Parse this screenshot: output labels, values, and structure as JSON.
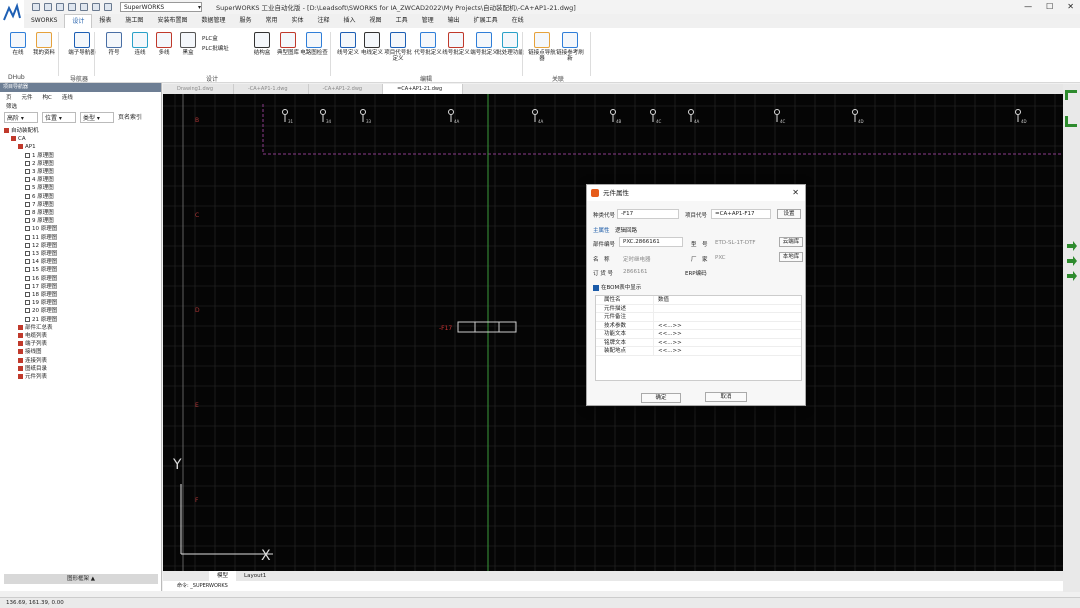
{
  "app": {
    "title": "SuperWORKS 工业自动化版 - [D:\\Leadsoft\\SWORKS for IA_ZWCAD2022\\My Projects\\自动装配机\\-CA+AP1-21.dwg]",
    "workspace": "SuperWORKS"
  },
  "ribbon_tabs": [
    "SWORKS",
    "设计",
    "报表",
    "施工图",
    "安装布置图",
    "数据管理",
    "服务",
    "常用",
    "实体",
    "注释",
    "插入",
    "视图",
    "工具",
    "管理",
    "输出",
    "扩展工具",
    "在线"
  ],
  "ribbon": {
    "buttons": [
      {
        "l": "在线"
      },
      {
        "l": "我的资料"
      },
      {
        "l": "端子导航器"
      },
      {
        "l": "符号"
      },
      {
        "l": "连线"
      },
      {
        "l": "多线"
      },
      {
        "l": "黑盒"
      },
      {
        "l": "PLC盒"
      },
      {
        "l": "PLC批编址"
      },
      {
        "l": "结构盒"
      },
      {
        "l": "典型图库"
      },
      {
        "l": "电路图检查"
      },
      {
        "l": "线号定义"
      },
      {
        "l": "电线定义"
      },
      {
        "l": "项目代号批定义"
      },
      {
        "l": "代号批定义"
      },
      {
        "l": "线号批定义"
      },
      {
        "l": "端号批定义"
      },
      {
        "l": "批处理功能"
      },
      {
        "l": "链接点导航器"
      },
      {
        "l": "链接参考刷新"
      }
    ],
    "groups": [
      "DHub",
      "导航器",
      "设计",
      "编辑",
      "关联"
    ]
  },
  "left_panel": {
    "title": "项目导航器",
    "tabs": [
      "页",
      "元件",
      "构C",
      "连线"
    ],
    "filter": "筛选",
    "selects": [
      "高阶",
      "位置",
      "类型"
    ],
    "hint": "页名索引",
    "bottom_button": "图形框架 ▲",
    "tree": [
      {
        "t": "自动装配机",
        "d": 0
      },
      {
        "t": "CA",
        "d": 1
      },
      {
        "t": "AP1",
        "d": 2
      },
      {
        "t": "1 原理图",
        "d": 3
      },
      {
        "t": "2 原理图",
        "d": 3
      },
      {
        "t": "3 原理图",
        "d": 3
      },
      {
        "t": "4 原理图",
        "d": 3
      },
      {
        "t": "5 原理图",
        "d": 3
      },
      {
        "t": "6 原理图",
        "d": 3
      },
      {
        "t": "7 原理图",
        "d": 3
      },
      {
        "t": "8 原理图",
        "d": 3
      },
      {
        "t": "9 原理图",
        "d": 3
      },
      {
        "t": "10 原理图",
        "d": 3
      },
      {
        "t": "11 原理图",
        "d": 3
      },
      {
        "t": "12 原理图",
        "d": 3
      },
      {
        "t": "13 原理图",
        "d": 3
      },
      {
        "t": "14 原理图",
        "d": 3
      },
      {
        "t": "15 原理图",
        "d": 3
      },
      {
        "t": "16 原理图",
        "d": 3
      },
      {
        "t": "17 原理图",
        "d": 3
      },
      {
        "t": "18 原理图",
        "d": 3
      },
      {
        "t": "19 原理图",
        "d": 3
      },
      {
        "t": "20 原理图",
        "d": 3
      },
      {
        "t": "21 原理图",
        "d": 3
      },
      {
        "t": "部件汇总表",
        "d": 2
      },
      {
        "t": "电缆列表",
        "d": 2
      },
      {
        "t": "端子列表",
        "d": 2
      },
      {
        "t": "接线图",
        "d": 2
      },
      {
        "t": "连接列表",
        "d": 2
      },
      {
        "t": "图纸目录",
        "d": 2
      },
      {
        "t": "元件列表",
        "d": 2
      }
    ]
  },
  "doc_tabs": [
    "Drawing1.dwg",
    "-CA+AP1-1.dwg",
    "-CA+AP1-2.dwg",
    "=CA+AP1-21.dwg"
  ],
  "layout_tabs": [
    "模型",
    "Layout1"
  ],
  "dialog": {
    "title": "元件属性",
    "kind_label": "种类代号",
    "kind_value": "-F17",
    "proj_label": "项目代号",
    "proj_value": "=CA+AP1-F17",
    "setting": "设置",
    "tabs": [
      "主属性",
      "逻辑回路"
    ],
    "part_label": "部件编号",
    "part_value": "PXC.2866161",
    "model_label": "型　号",
    "model_value": "ETD-SL-1T-DTF",
    "cloud": "云端库",
    "name_label": "名　称",
    "name_value": "定时继电器",
    "maker_label": "厂　家",
    "maker_value": "PXC",
    "local": "本地库",
    "order_label": "订 货 号",
    "order_value": "2866161",
    "erp_label": "ERP编码",
    "bom": "在BOM表中显示",
    "props_head": [
      "属性名",
      "数值"
    ],
    "props": [
      [
        "元件描述",
        ""
      ],
      [
        "元件备注",
        ""
      ],
      [
        "技术参数",
        "<<...>>"
      ],
      [
        "功能文本",
        "<<...>>"
      ],
      [
        "铭牌文本",
        "<<...>>"
      ],
      [
        "装配地点",
        "<<...>>"
      ]
    ],
    "ok": "确定",
    "cancel": "取消"
  },
  "canvas": {
    "col_labels": [
      "31",
      "34",
      "33",
      "4A",
      "4A",
      "4B",
      "4C",
      "4A",
      "4C",
      "4D",
      "4D"
    ],
    "row_labels": [
      "B",
      "C",
      "D",
      "E",
      "F"
    ],
    "device": "-F17"
  },
  "status": {
    "coords": "136.69, 161.39, 0.00",
    "cmd": "命令: _SUPERWORKS"
  }
}
